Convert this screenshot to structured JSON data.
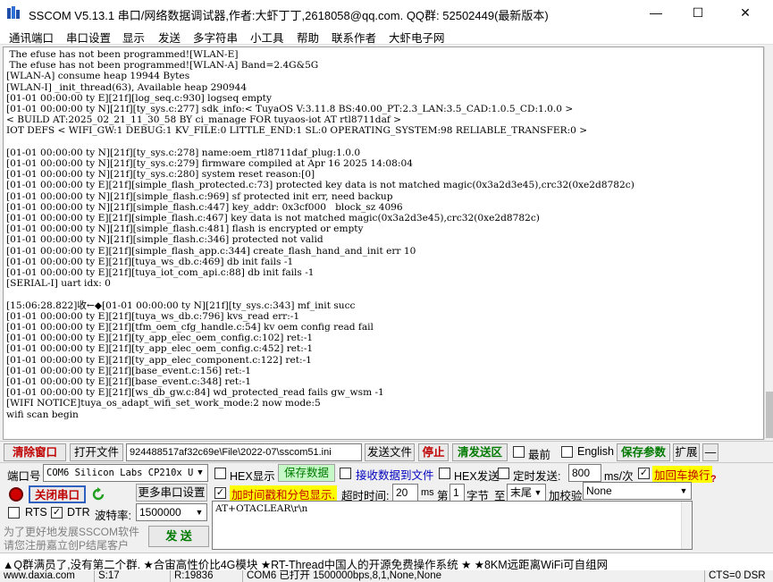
{
  "window": {
    "title": "SSCOM V5.13.1 串口/网络数据调试器,作者:大虾丁丁,2618058@qq.com. QQ群: 52502449(最新版本)",
    "minimize_glyph": "—",
    "maximize_glyph": "☐",
    "close_glyph": "✕",
    "icon": "sscom-app-icon"
  },
  "menu": [
    "通讯端口",
    "串口设置",
    "显示",
    "发送",
    "多字符串",
    "小工具",
    "帮助",
    "联系作者",
    "大虾电子网"
  ],
  "terminal": {
    "lines": [
      " The efuse has not been programmed![WLAN-E]",
      " The efuse has not been programmed![WLAN-A] Band=2.4G&5G",
      "[WLAN-A] consume heap 19944 Bytes",
      "[WLAN-I] _init_thread(63), Available heap 290944",
      "[01-01 00:00:00 ty E][21f][log_seq.c:930] logseq empty",
      "[01-01 00:00:00 ty N][21f][ty_sys.c:277] sdk_info:< TuyaOS V:3.11.8 BS:40.00_PT:2.3_LAN:3.5_CAD:1.0.5_CD:1.0.0 >",
      "< BUILD AT:2025_02_21_11_30_58 BY ci_manage FOR tuyaos-iot AT rtl8711daf >",
      "IOT DEFS < WIFI_GW:1 DEBUG:1 KV_FILE:0 LITTLE_END:1 SL:0 OPERATING_SYSTEM:98 RELIABLE_TRANSFER:0 >",
      "",
      "[01-01 00:00:00 ty N][21f][ty_sys.c:278] name:oem_rtl8711daf_plug:1.0.0",
      "[01-01 00:00:00 ty N][21f][ty_sys.c:279] firmware compiled at Apr 16 2025 14:08:04",
      "[01-01 00:00:00 ty N][21f][ty_sys.c:280] system reset reason:[0]",
      "[01-01 00:00:00 ty E][21f][simple_flash_protected.c:73] protected key data is not matched magic(0x3a2d3e45),crc32(0xe2d8782c)",
      "[01-01 00:00:00 ty N][21f][simple_flash.c:969] sf protected init err, need backup",
      "[01-01 00:00:00 ty N][21f][simple_flash.c:447] key_addr: 0x3cf000   block_sz 4096",
      "[01-01 00:00:00 ty E][21f][simple_flash.c:467] key data is not matched magic(0x3a2d3e45),crc32(0xe2d8782c)",
      "[01-01 00:00:00 ty N][21f][simple_flash.c:481] flash is encrypted or empty",
      "[01-01 00:00:00 ty N][21f][simple_flash.c:346] protected not valid",
      "[01-01 00:00:00 ty E][21f][simple_flash_app.c:344] create_flash_hand_and_init err 10",
      "[01-01 00:00:00 ty E][21f][tuya_ws_db.c:469] db init fails -1",
      "[01-01 00:00:00 ty E][21f][tuya_iot_com_api.c:88] db init fails -1",
      "[SERIAL-I] uart idx: 0",
      "",
      "[15:06:28.822]收←◆[01-01 00:00:00 ty N][21f][ty_sys.c:343] mf_init succ",
      "[01-01 00:00:00 ty E][21f][tuya_ws_db.c:796] kvs_read err:-1",
      "[01-01 00:00:00 ty E][21f][tfm_oem_cfg_handle.c:54] kv oem config read fail",
      "[01-01 00:00:00 ty E][21f][ty_app_elec_oem_config.c:102] ret:-1",
      "[01-01 00:00:00 ty E][21f][ty_app_elec_oem_config.c:452] ret:-1",
      "[01-01 00:00:00 ty E][21f][ty_app_elec_component.c:122] ret:-1",
      "[01-01 00:00:00 ty E][21f][base_event.c:156] ret:-1",
      "[01-01 00:00:00 ty E][21f][base_event.c:348] ret:-1",
      "[01-01 00:00:00 ty E][21f][ws_db_gw.c:84] wd_protected_read fails gw_wsm -1",
      "[WIFI NOTICE]tuya_os_adapt_wifi_set_work_mode:2 now mode:5",
      "wifi scan begin"
    ]
  },
  "toolbar": {
    "clear_window": "清除窗口",
    "open_file": "打开文件",
    "file_path": "924488517af32c69e\\File\\2022-07\\sscom51.ini",
    "send_file": "发送文件",
    "stop": "停止",
    "clear_send_area": "清发送区",
    "topmost": "最前",
    "english": "English",
    "save_params": "保存参数",
    "expand": "扩展",
    "collapse": "—"
  },
  "port": {
    "label": "端口号",
    "value": "COM6 Silicon Labs CP210x U",
    "more_settings": "更多串口设置",
    "close_port": "关闭串口",
    "rts": "RTS",
    "dtr": "DTR",
    "baud_label": "波特率:",
    "baud_value": "1500000",
    "rts_checked": false,
    "dtr_checked": true
  },
  "options": {
    "hex_display": "HEX显示",
    "save_data": "保存数据",
    "recv_to_file": "接收数据到文件",
    "hex_send": "HEX发送",
    "timed_send": "定时发送:",
    "timed_value": "800",
    "timed_unit": "ms/次",
    "add_crlf": "加回车换行",
    "timestamp": "加时间戳和分包显示.",
    "timeout_label": "超时时间:",
    "timeout_value": "20",
    "timeout_unit": "ms",
    "page_label": "第",
    "page_value": "1",
    "byte_label": "字节",
    "to_label": "至",
    "to_value": "末尾",
    "checksum_label": "加校验",
    "checksum_value": "None",
    "help_mark": "?"
  },
  "send": {
    "text": "AT+OTACLEAR\\r\\n",
    "button": "发 送",
    "promo1": "为了更好地发展SSCOM软件",
    "promo2": "请您注册嘉立创P结尾客户"
  },
  "ticker": "▲Q群满员了,没有第二个群.  ★合宙高性价比4G模块  ★RT-Thread中国人的开源免费操作系统  ★  ★8KM远距离WiFi可自组网",
  "status": {
    "website": "www.daxia.com",
    "s": "S:17",
    "r": "R:19836",
    "port_info": "COM6 已打开  1500000bps,8,1,None,None",
    "signals": "CTS=0 DSR"
  },
  "colors": {
    "red_text": "#c00000",
    "green_text": "#007a00",
    "highlight_yellow": "#ffff00",
    "highlight_green": "#c6f7c6"
  }
}
